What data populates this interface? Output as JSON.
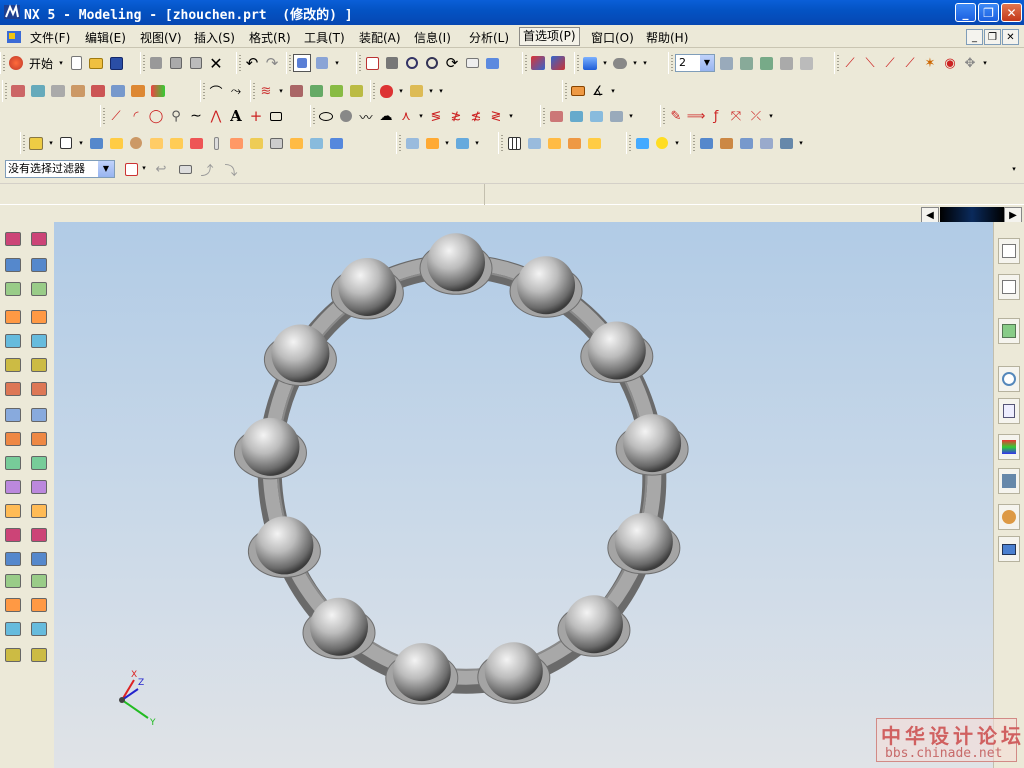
{
  "window": {
    "title": "NX 5 - Modeling - [zhouchen.prt  (修改的) ]",
    "minimize_label": "_",
    "maximize_label": "❐",
    "close_label": "✕"
  },
  "menu": {
    "items": [
      {
        "label": "文件(F)"
      },
      {
        "label": "编辑(E)"
      },
      {
        "label": "视图(V)"
      },
      {
        "label": "插入(S)"
      },
      {
        "label": "格式(R)"
      },
      {
        "label": "工具(T)"
      },
      {
        "label": "装配(A)"
      },
      {
        "label": "信息(I)"
      },
      {
        "label": "分析(L)"
      },
      {
        "label": "首选项(P)"
      },
      {
        "label": "窗口(O)"
      },
      {
        "label": "帮助(H)"
      }
    ],
    "active_index": 9,
    "doc_min": "_",
    "doc_restore": "❐",
    "doc_close": "✕"
  },
  "toolbar": {
    "start_label": "开始",
    "layer_value": "2"
  },
  "selection": {
    "filter_value": "没有选择过滤器"
  },
  "watermark": {
    "cn": "中华设计论坛",
    "url": "bbs.chinade.net"
  },
  "triad": {
    "x_label": "X",
    "y_label": "Y",
    "z_label": "Z"
  },
  "colors": {
    "titlebar": "#0453c4",
    "viewport_top": "#b1cbe6",
    "viewport_bottom": "#e0e3e7",
    "ring": "#8c8c8c",
    "sphere": "#c0c0c0"
  }
}
